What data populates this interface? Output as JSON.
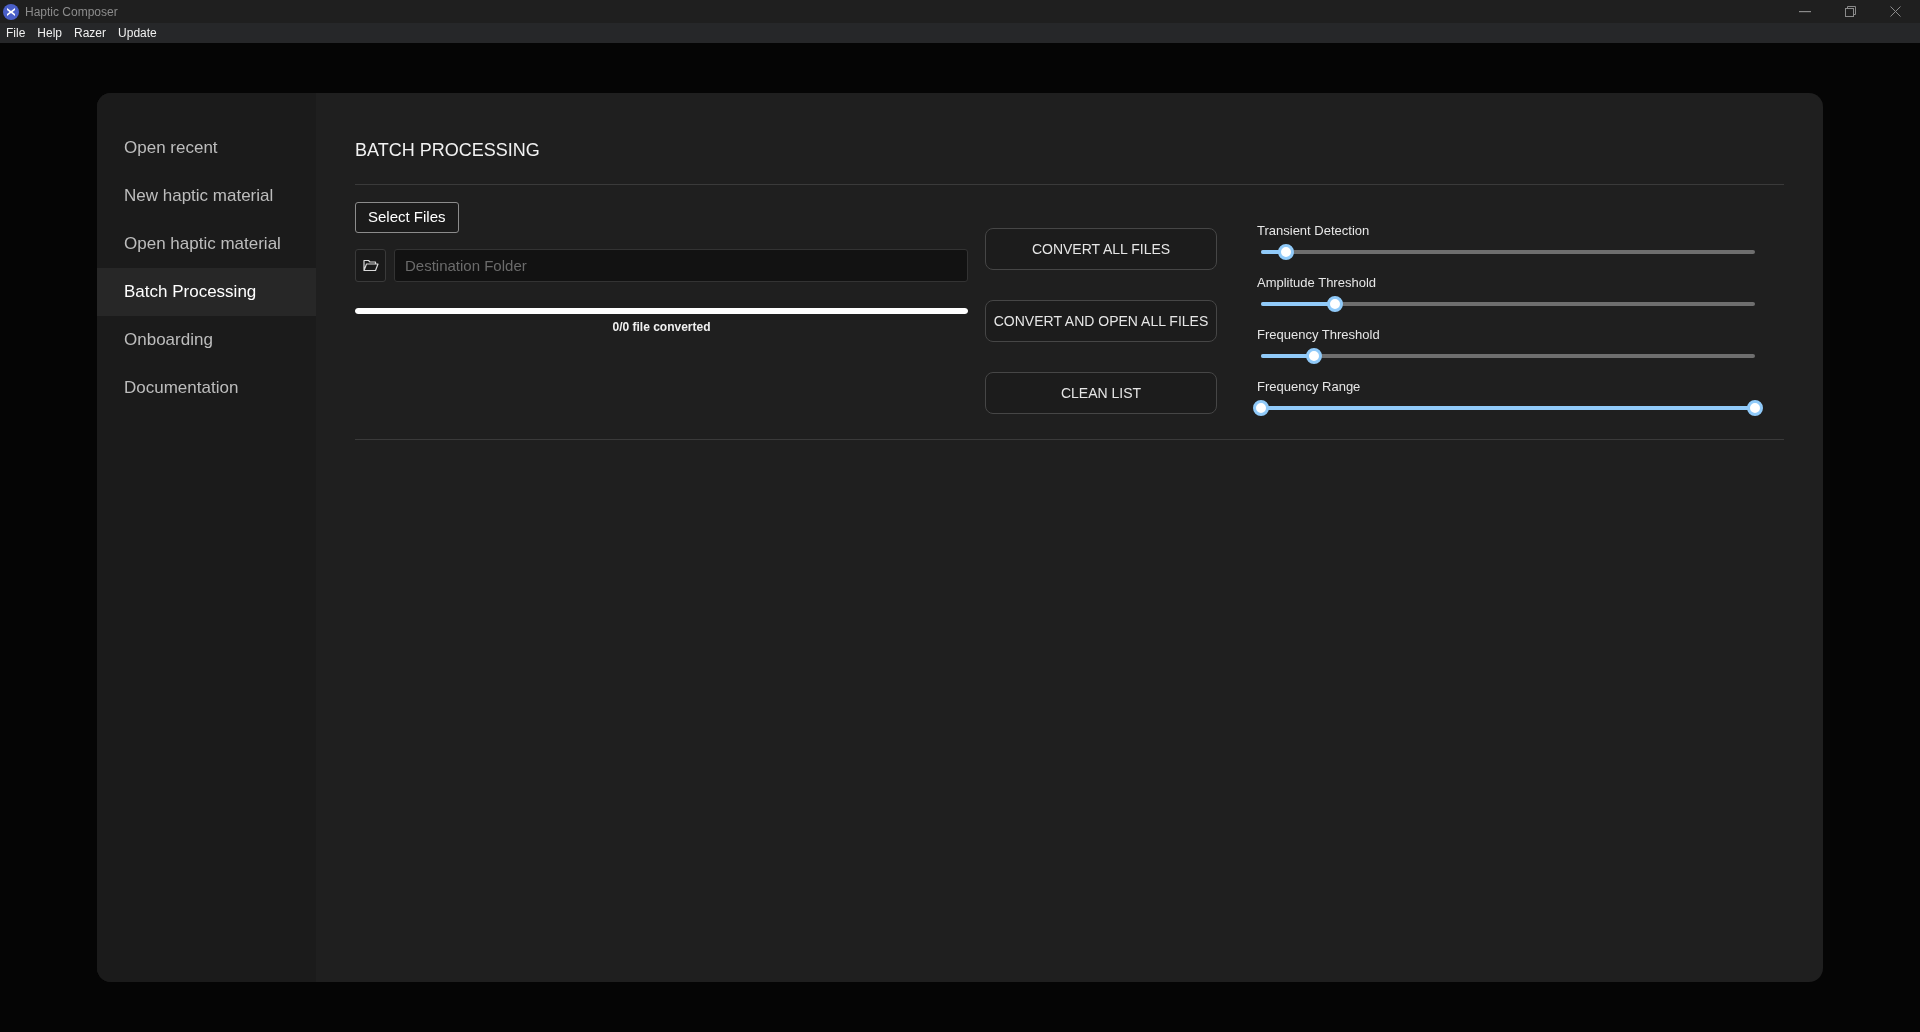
{
  "window": {
    "title": "Haptic Composer"
  },
  "menu": [
    "File",
    "Help",
    "Razer",
    "Update"
  ],
  "sidebar": {
    "items": [
      {
        "label": "Open recent",
        "selected": false
      },
      {
        "label": "New haptic material",
        "selected": false
      },
      {
        "label": "Open haptic material",
        "selected": false
      },
      {
        "label": "Batch Processing",
        "selected": true
      },
      {
        "label": "Onboarding",
        "selected": false
      },
      {
        "label": "Documentation",
        "selected": false
      }
    ]
  },
  "page": {
    "title": "BATCH PROCESSING",
    "select_button": "Select Files",
    "destination": {
      "placeholder": "Destination Folder"
    },
    "progress": {
      "level": 1,
      "text": "0/0 file converted"
    },
    "actions": [
      "CONVERT ALL FILES",
      "CONVERT AND OPEN ALL FILES",
      "CLEAN LIST"
    ],
    "sliders": [
      {
        "label": "Transient Detection",
        "kind": "single",
        "level": 0.05
      },
      {
        "label": "Amplitude Threshold",
        "kind": "single",
        "level": 0.15
      },
      {
        "label": "Frequency Threshold",
        "kind": "single",
        "level": 0.107
      },
      {
        "label": "Frequency Range",
        "kind": "range",
        "thumbs": [
          {
            "level": 0
          },
          {
            "level": 1
          }
        ]
      }
    ]
  }
}
